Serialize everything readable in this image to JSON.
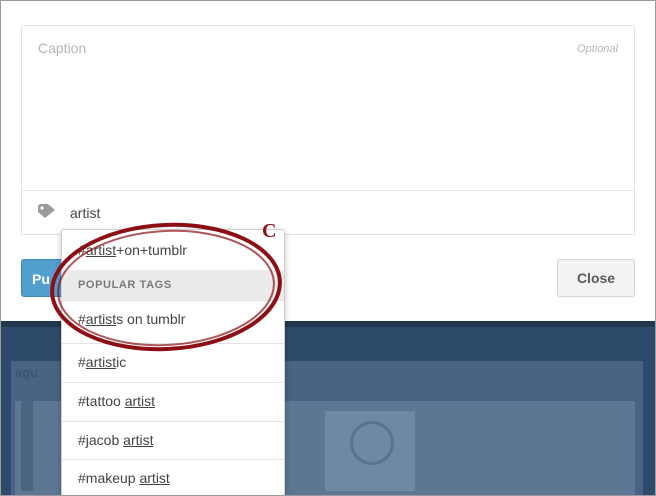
{
  "composer": {
    "caption_placeholder": "Caption",
    "caption_optional": "Optional",
    "tag_input_value": "artist",
    "post_button_label": "Pu",
    "close_button_label": "Close"
  },
  "autocomplete": {
    "typed": "artist",
    "items": [
      {
        "prefix": "#",
        "match": "artist",
        "suffix": "+on+tumblr"
      },
      {
        "prefix": "#",
        "match": "artist",
        "suffix": "s on tumblr"
      },
      {
        "prefix": "#",
        "match": "artist",
        "suffix": "ic"
      },
      {
        "prefix": "#tattoo ",
        "match": "artist",
        "suffix": ""
      },
      {
        "prefix": "#jacob ",
        "match": "artist",
        "suffix": ""
      },
      {
        "prefix": "#makeup ",
        "match": "artist",
        "suffix": ""
      }
    ],
    "section_header": "POPULAR TAGS"
  },
  "background": {
    "label": "agu"
  },
  "annotation": {
    "letter": "C",
    "color": "#8b0f14"
  },
  "colors": {
    "post_button": "#529ecc",
    "dashboard_bg": "#2e4a6a"
  }
}
